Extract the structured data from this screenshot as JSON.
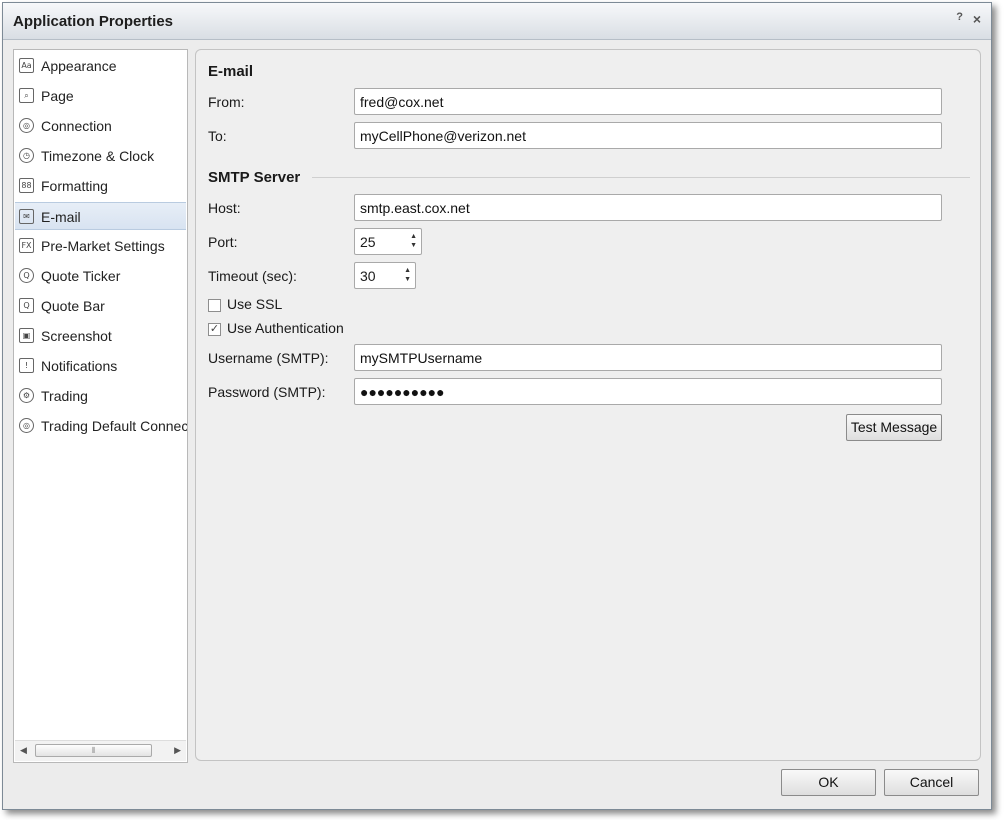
{
  "window": {
    "title": "Application Properties",
    "help": "?",
    "close": "×"
  },
  "sidebar": {
    "items": [
      {
        "label": "Appearance",
        "icon": "Aa"
      },
      {
        "label": "Page",
        "icon": "⌕"
      },
      {
        "label": "Connection",
        "icon": "◎"
      },
      {
        "label": "Timezone & Clock",
        "icon": "◷"
      },
      {
        "label": "Formatting",
        "icon": "88"
      },
      {
        "label": "E-mail",
        "icon": "✉"
      },
      {
        "label": "Pre-Market Settings",
        "icon": "FX"
      },
      {
        "label": "Quote Ticker",
        "icon": "Q"
      },
      {
        "label": "Quote Bar",
        "icon": "Q"
      },
      {
        "label": "Screenshot",
        "icon": "▣"
      },
      {
        "label": "Notifications",
        "icon": "!"
      },
      {
        "label": "Trading",
        "icon": "⚙"
      },
      {
        "label": "Trading Default Connectic",
        "icon": "◎"
      }
    ],
    "selected_index": 5,
    "scroll": {
      "left": "◀",
      "right": "▶",
      "grip": "⦀"
    }
  },
  "email": {
    "heading": "E-mail",
    "from_label": "From:",
    "from_value": "fred@cox.net",
    "to_label": "To:",
    "to_value": "myCellPhone@verizon.net"
  },
  "smtp": {
    "heading": "SMTP Server",
    "host_label": "Host:",
    "host_value": "smtp.east.cox.net",
    "port_label": "Port:",
    "port_value": "25",
    "timeout_label": "Timeout (sec):",
    "timeout_value": "30",
    "use_ssl_label": "Use SSL",
    "use_ssl_checked": false,
    "use_auth_label": "Use Authentication",
    "use_auth_checked": true,
    "check_mark": "✓",
    "username_label": "Username (SMTP):",
    "username_value": "mySMTPUsername",
    "password_label": "Password (SMTP):",
    "password_value": "●●●●●●●●●●",
    "test_button": "Test Message"
  },
  "footer": {
    "ok": "OK",
    "cancel": "Cancel"
  },
  "spinner_arrows": {
    "up": "▲",
    "down": "▼"
  },
  "colors": {
    "selected_bg": "#dce6f2",
    "dialog_bg": "#ececec",
    "title_bar": "#e2e6ea"
  }
}
